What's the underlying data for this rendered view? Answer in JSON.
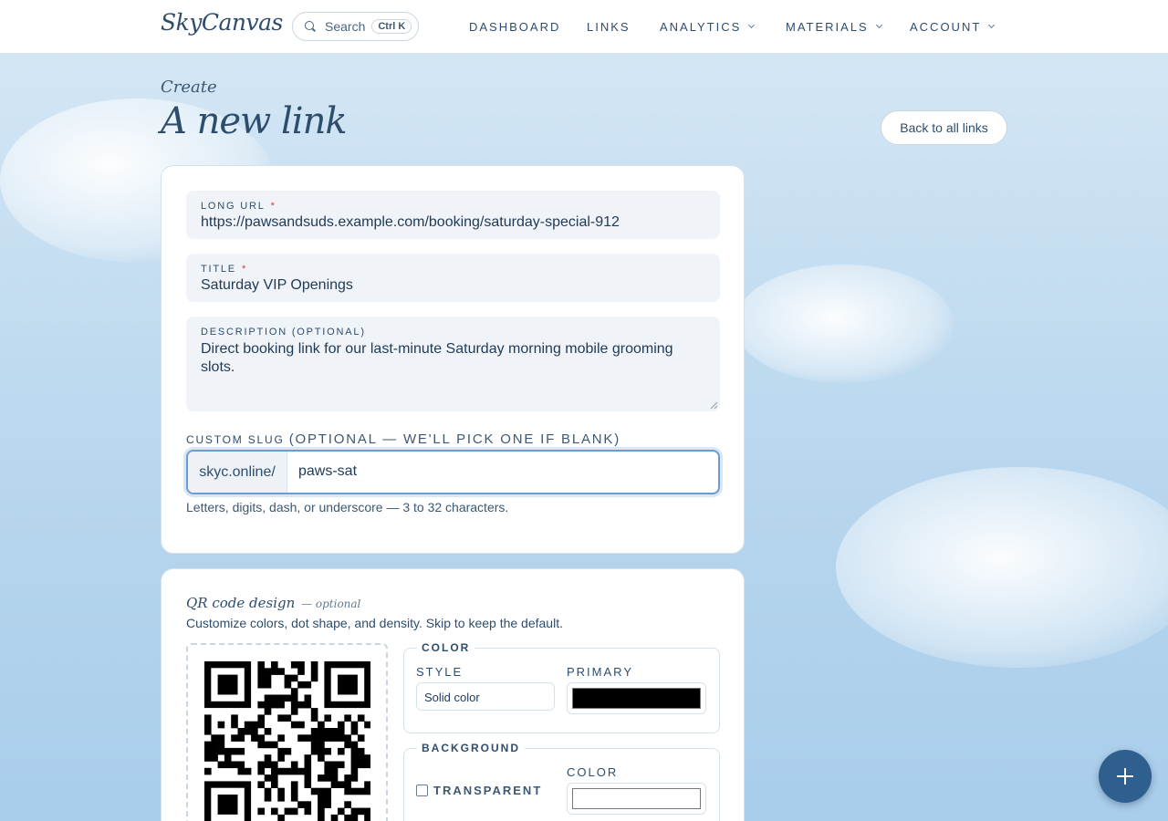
{
  "header": {
    "logo": "SkyCanvas",
    "search_label": "Search",
    "search_shortcut": "Ctrl K",
    "nav": [
      {
        "label": "DASHBOARD",
        "has_menu": false
      },
      {
        "label": "LINKS",
        "has_menu": false
      },
      {
        "label": "ANALYTICS",
        "has_menu": true
      },
      {
        "label": "MATERIALS",
        "has_menu": true
      },
      {
        "label": "ACCOUNT",
        "has_menu": true
      }
    ]
  },
  "page": {
    "eyebrow": "Create",
    "title": "A new link",
    "back_button": "Back to all links"
  },
  "form": {
    "long_url": {
      "label": "LONG URL",
      "required_mark": "*",
      "value": "https://pawsandsuds.example.com/booking/saturday-special-912"
    },
    "title": {
      "label": "TITLE",
      "required_mark": "*",
      "value": "Saturday VIP Openings"
    },
    "description": {
      "label": "DESCRIPTION (OPTIONAL)",
      "value": "Direct booking link for our last-minute Saturday morning mobile grooming slots."
    },
    "slug": {
      "label": "CUSTOM SLUG",
      "optional_note": "(OPTIONAL — WE'LL PICK ONE IF BLANK)",
      "prefix": "skyc.online/",
      "value": "paws-sat",
      "hint": "Letters, digits, dash, or underscore — 3 to 32 characters."
    }
  },
  "qr": {
    "title": "QR code design",
    "title_note": "— optional",
    "subtitle": "Customize colors, dot shape, and density. Skip to keep the default.",
    "color_section": {
      "legend": "COLOR",
      "style_label": "STYLE",
      "style_value": "Solid color",
      "primary_label": "PRIMARY",
      "primary_color": "#000000"
    },
    "background_section": {
      "legend": "BACKGROUND",
      "transparent_label": "TRANSPARENT",
      "transparent_checked": false,
      "color_label": "COLOR",
      "color_value": "#ffffff"
    }
  },
  "colors": {
    "accent": "#2f5f8f",
    "text": "#1f3a55",
    "required": "#d43a3a",
    "focus": "#6b9cd0"
  },
  "fab": {
    "icon": "plus-icon"
  }
}
